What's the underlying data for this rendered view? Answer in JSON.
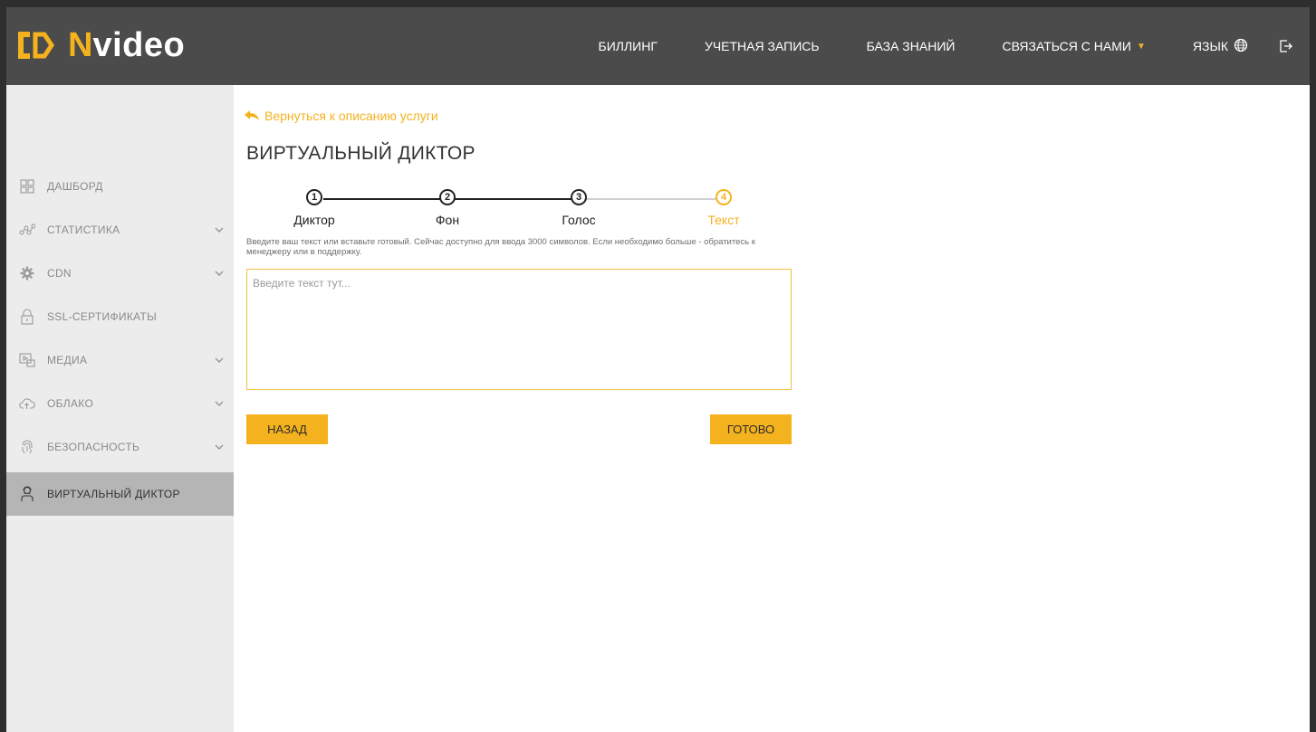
{
  "brand": {
    "logo_main": "video",
    "logo_n": "N",
    "accent_color": "#f5b21f",
    "header_bg": "#4b4b4b"
  },
  "header": {
    "nav": [
      {
        "label": "БИЛЛИНГ"
      },
      {
        "label": "УЧЕТНАЯ ЗАПИСЬ"
      },
      {
        "label": "БАЗА ЗНАНИЙ"
      },
      {
        "label": "СВЯЗАТЬСЯ С НАМИ",
        "icon": "caret-down-icon"
      },
      {
        "label": "ЯЗЫК",
        "icon": "globe-icon"
      }
    ],
    "logout_icon": "logout-icon"
  },
  "sidebar": {
    "items": [
      {
        "label": "ДАШБОРД",
        "icon": "dashboard-icon",
        "expandable": false
      },
      {
        "label": "СТАТИСТИКА",
        "icon": "statistics-icon",
        "expandable": true
      },
      {
        "label": "CDN",
        "icon": "gear-icon",
        "expandable": true
      },
      {
        "label": "SSL-СЕРТИФИКАТЫ",
        "icon": "lock-icon",
        "expandable": false
      },
      {
        "label": "МЕДИА",
        "icon": "media-icon",
        "expandable": true
      },
      {
        "label": "ОБЛАКО",
        "icon": "cloud-icon",
        "expandable": true
      },
      {
        "label": "БЕЗОПАСНОСТЬ",
        "icon": "fingerprint-icon",
        "expandable": true
      },
      {
        "label": "ВИРТУАЛЬНЫЙ ДИКТОР",
        "icon": "speaker-person-icon",
        "expandable": false,
        "active": true
      }
    ]
  },
  "main": {
    "back_link": "Вернуться к описанию услуги",
    "title": "ВИРТУАЛЬНЫЙ ДИКТОР",
    "steps": [
      {
        "number": "1",
        "label": "Диктор",
        "state": "done"
      },
      {
        "number": "2",
        "label": "Фон",
        "state": "done"
      },
      {
        "number": "3",
        "label": "Голос",
        "state": "done"
      },
      {
        "number": "4",
        "label": "Текст",
        "state": "current"
      }
    ],
    "hint": "Введите ваш текст или вставьте готовый. Сейчас доступно для ввода 3000 символов. Если необходимо больше - обратитесь к менеджеру или в поддержку.",
    "text_input": {
      "value": "",
      "placeholder": "Введите текст тут..."
    },
    "buttons": {
      "back": "НАЗАД",
      "done": "ГОТОВО"
    }
  }
}
